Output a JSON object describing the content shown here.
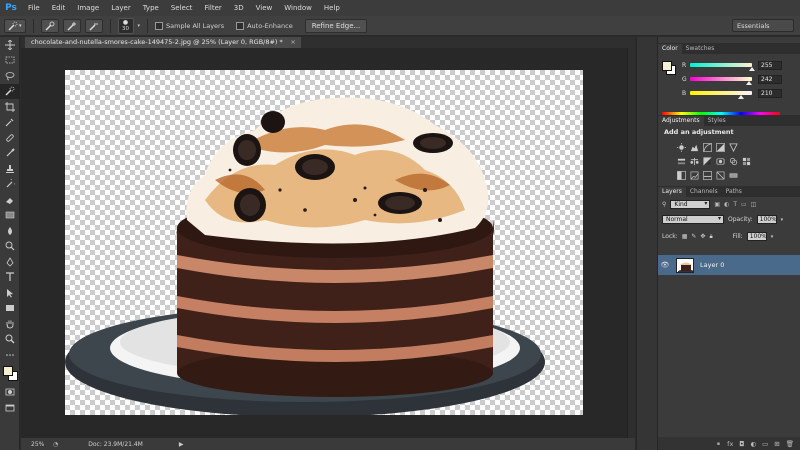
{
  "app": {
    "logo": "Ps"
  },
  "menu": [
    "File",
    "Edit",
    "Image",
    "Layer",
    "Type",
    "Select",
    "Filter",
    "3D",
    "View",
    "Window",
    "Help"
  ],
  "options": {
    "brush_size": "30",
    "sample_all_layers": "Sample All Layers",
    "auto_enhance": "Auto-Enhance",
    "refine_edge": "Refine Edge...",
    "workspace": "Essentials"
  },
  "document": {
    "tab_title": "chocolate-and-nutella-smores-cake-149475-2.jpg @ 25% (Layer 0, RGB/8#) *",
    "zoom": "25%",
    "doc_info": "Doc: 23.9M/21.4M"
  },
  "color_panel": {
    "tabs": [
      "Color",
      "Swatches"
    ],
    "r_label": "R",
    "r_value": "255",
    "g_label": "G",
    "g_value": "242",
    "b_label": "B",
    "b_value": "210",
    "foreground": "#f7efd2"
  },
  "adjustments_panel": {
    "tabs": [
      "Adjustments",
      "Styles"
    ],
    "title": "Add an adjustment"
  },
  "layers_panel": {
    "tabs": [
      "Layers",
      "Channels",
      "Paths"
    ],
    "kind": "Kind",
    "blend_mode": "Normal",
    "opacity_label": "Opacity:",
    "opacity_value": "100%",
    "lock_label": "Lock:",
    "fill_label": "Fill:",
    "fill_value": "100%",
    "layer_name": "Layer 0"
  }
}
